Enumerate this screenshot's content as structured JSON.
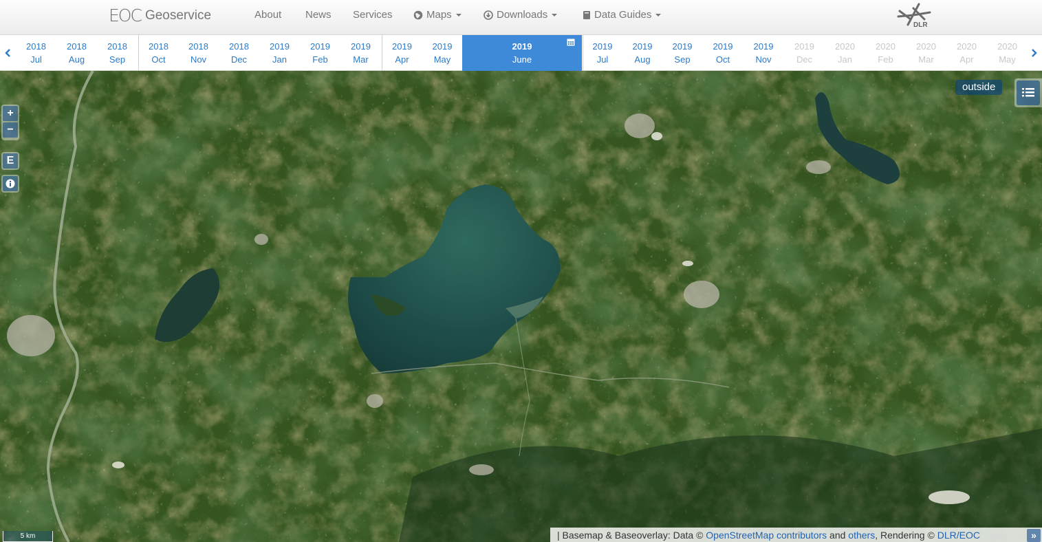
{
  "navbar": {
    "brand_logo": "EOC",
    "brand_name": "Geoservice",
    "links": {
      "about": "About",
      "news": "News",
      "services": "Services",
      "maps": "Maps",
      "downloads": "Downloads",
      "data_guides": "Data Guides"
    },
    "dlr_label": "DLR"
  },
  "timeline": {
    "months": [
      {
        "year": "2018",
        "month": "Jul",
        "state": "normal"
      },
      {
        "year": "2018",
        "month": "Aug",
        "state": "normal"
      },
      {
        "year": "2018",
        "month": "Sep",
        "state": "normal"
      },
      {
        "year": "2018",
        "month": "Oct",
        "state": "normal"
      },
      {
        "year": "2018",
        "month": "Nov",
        "state": "normal"
      },
      {
        "year": "2018",
        "month": "Dec",
        "state": "normal"
      },
      {
        "year": "2019",
        "month": "Jan",
        "state": "normal"
      },
      {
        "year": "2019",
        "month": "Feb",
        "state": "normal"
      },
      {
        "year": "2019",
        "month": "Mar",
        "state": "normal"
      },
      {
        "year": "2019",
        "month": "Apr",
        "state": "normal"
      },
      {
        "year": "2019",
        "month": "May",
        "state": "normal"
      },
      {
        "year": "2019",
        "month": "June",
        "state": "active"
      },
      {
        "year": "2019",
        "month": "Jul",
        "state": "normal"
      },
      {
        "year": "2019",
        "month": "Aug",
        "state": "normal"
      },
      {
        "year": "2019",
        "month": "Sep",
        "state": "normal"
      },
      {
        "year": "2019",
        "month": "Oct",
        "state": "normal"
      },
      {
        "year": "2019",
        "month": "Nov",
        "state": "normal"
      },
      {
        "year": "2019",
        "month": "Dec",
        "state": "disabled"
      },
      {
        "year": "2020",
        "month": "Jan",
        "state": "disabled"
      },
      {
        "year": "2020",
        "month": "Feb",
        "state": "disabled"
      },
      {
        "year": "2020",
        "month": "Mar",
        "state": "disabled"
      },
      {
        "year": "2020",
        "month": "Apr",
        "state": "disabled"
      },
      {
        "year": "2020",
        "month": "May",
        "state": "disabled"
      }
    ]
  },
  "map": {
    "zoom_in": "+",
    "zoom_out": "−",
    "export_btn": "E",
    "outside_label": "outside",
    "scale_label": "5 km",
    "attribution": {
      "prefix": "| Basemap & Baseoverlay: Data ©",
      "osm_link": "OpenStreetMap contributors",
      "and": "and",
      "others_link": "others",
      "rendering": ", Rendering ©",
      "dlr_link": "DLR/EOC"
    },
    "attr_toggle": "»"
  },
  "colors": {
    "accent": "#3f89d9",
    "link": "#2a7ac8",
    "control_bg": "#003c88"
  }
}
